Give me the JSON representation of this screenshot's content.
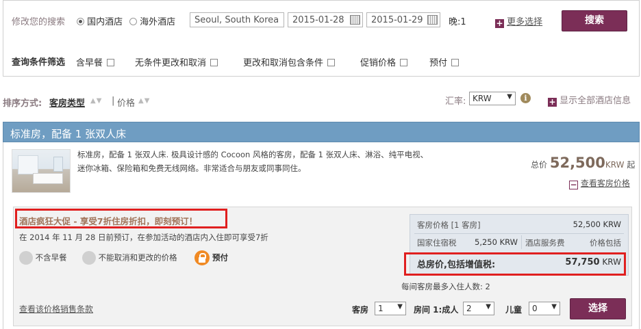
{
  "search": {
    "modify_label": "修改您的搜索",
    "radio_domestic": "国内酒店",
    "radio_overseas": "海外酒店",
    "destination": "Seoul, South Korea",
    "checkin": "2015-01-28",
    "checkout": "2015-01-29",
    "nights_label": "晚:1",
    "more_options": "更多选择",
    "search_button": "搜索"
  },
  "filters": {
    "title": "查询条件筛选",
    "items": [
      "含早餐",
      "无条件更改和取消",
      "更改和取消包含条件",
      "促销价格",
      "预付"
    ]
  },
  "sort": {
    "label": "排序方式:",
    "room_type": "客房类型",
    "separator": "|",
    "price": "价格",
    "currency_label": "汇率:",
    "currency_value": "KRW",
    "show_all_info": "显示全部酒店信息"
  },
  "room": {
    "title": "标准房，配备 1 张双人床",
    "description": "标准房，配备 1 张双人床. 极具设计感的 Cocoon 风格的客房，配备 1 张双人床、淋浴、纯平电视、迷你冰箱、保险箱和免费无线网络。非常适合与朋友或同事同住。",
    "total_label": "总价",
    "total_price": "52,500",
    "total_currency": "KRW",
    "total_suffix": "起",
    "view_prices": "查看客房价格"
  },
  "deal": {
    "promo_title": "酒店疯狂大促 - 享受7折住房折扣，即刻预订！",
    "promo_detail": "在 2014 年 11 月 28 日前预订，在参加活动的酒店内入住即可享受7折",
    "features": [
      "不含早餐",
      "不能取消和更改的价格",
      "预付"
    ],
    "terms_link": "查看该价格销售条款",
    "price_panel": {
      "room_price_label": "客房价格 [1 客房]",
      "room_price_value": "52,500 KRW",
      "tax_label": "国家住宿税",
      "tax_value": "5,250 KRW",
      "service_label": "酒店服务费",
      "service_value": "价格包括",
      "total_label": "总房价,包括增值税:",
      "total_value": "57,750",
      "total_currency": "KRW"
    },
    "max_guests": "每间客房最多入住人数: 2",
    "rooms_label": "客房",
    "rooms_value": "1",
    "adults_label": "房间 1:成人",
    "adults_value": "2",
    "children_label": "儿童",
    "children_value": "0",
    "select_button": "选择"
  }
}
